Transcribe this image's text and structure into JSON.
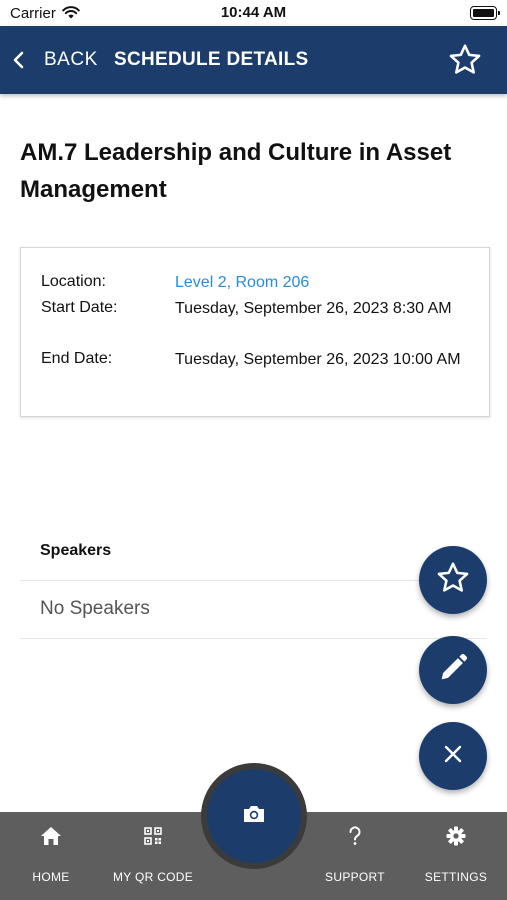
{
  "status_bar": {
    "carrier": "Carrier",
    "time": "10:44 AM"
  },
  "nav": {
    "back_label": "BACK",
    "title": "SCHEDULE DETAILS"
  },
  "session": {
    "title": "AM.7 Leadership and Culture in Asset Management",
    "location_label": "Location:",
    "location_value": "Level 2, Room 206",
    "start_label": "Start Date:",
    "start_value": "Tuesday, September 26, 2023 8:30 AM",
    "end_label": "End Date:",
    "end_value": "Tuesday, September 26, 2023 10:00 AM"
  },
  "speakers": {
    "header": "Speakers",
    "empty_text": "No Speakers"
  },
  "tabs": [
    {
      "label": "HOME",
      "icon": "home-icon"
    },
    {
      "label": "MY QR CODE",
      "icon": "qr-code-icon"
    },
    {
      "label": "SUPPORT",
      "icon": "question-icon"
    },
    {
      "label": "SETTINGS",
      "icon": "gear-icon"
    }
  ],
  "icons": {
    "fab_favorite": "star-icon",
    "fab_edit": "pencil-icon",
    "fab_close": "close-icon",
    "center": "camera-icon"
  },
  "colors": {
    "primary": "#1c3d6b",
    "link": "#2a8bd8",
    "tab_bar": "#5e5e5e"
  }
}
